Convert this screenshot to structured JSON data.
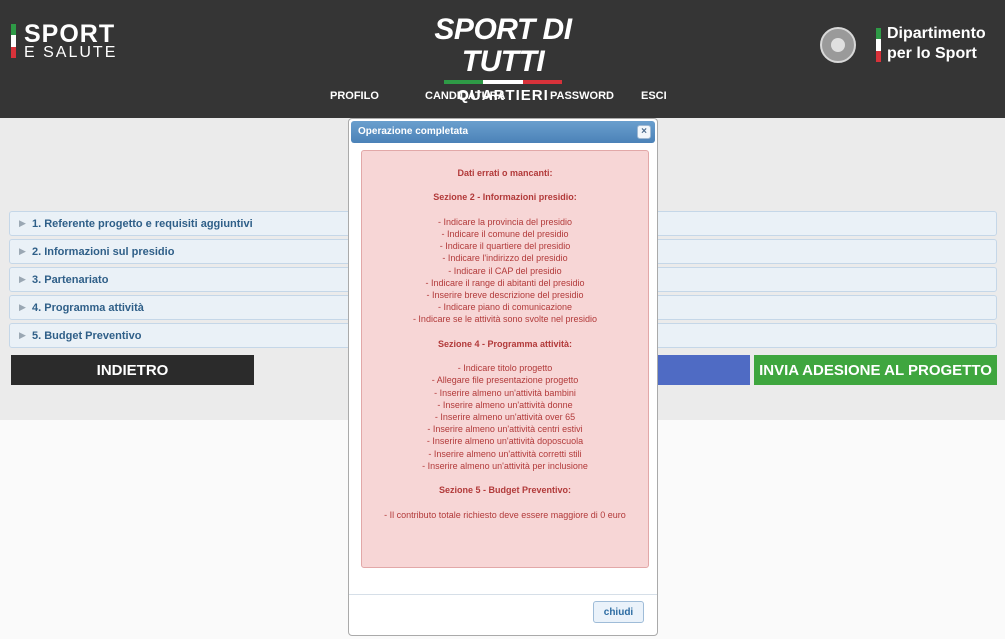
{
  "header": {
    "left_logo": {
      "line1": "SPORT",
      "line2": "E SALUTE"
    },
    "center_logo": {
      "line1": "SPORT DI TUTTI",
      "line2": "QUARTIERI"
    },
    "right_logo": {
      "line1": "Dipartimento",
      "line2": "per lo Sport"
    },
    "flag_colors": [
      "#2e9a46",
      "#ffffff",
      "#d8323a"
    ]
  },
  "nav": [
    "PROFILO",
    "CANDIDATURA",
    "PASSWORD",
    "ESCI"
  ],
  "accordion": [
    "1. Referente progetto e requisiti aggiuntivi",
    "2. Informazioni sul presidio",
    "3. Partenariato",
    "4. Programma attività",
    "5. Budget Preventivo"
  ],
  "buttons": {
    "back": "INDIETRO",
    "send": "INVIA ADESIONE AL PROGETTO"
  },
  "modal": {
    "title": "Operazione completata",
    "close_icon": "×",
    "close_button": "chiudi",
    "lines": [
      {
        "text": "Dati errati o mancanti:",
        "bold": true
      },
      {
        "text": "",
        "bold": false
      },
      {
        "text": "Sezione 2 - Informazioni presidio:",
        "bold": true
      },
      {
        "text": "",
        "bold": false
      },
      {
        "text": "- Indicare la provincia del presidio",
        "bold": false
      },
      {
        "text": "- Indicare il comune del presidio",
        "bold": false
      },
      {
        "text": "- Indicare il quartiere del presidio",
        "bold": false
      },
      {
        "text": "- Indicare l'indirizzo del presidio",
        "bold": false
      },
      {
        "text": "- Indicare il CAP del presidio",
        "bold": false
      },
      {
        "text": "- Indicare il range di abitanti del presidio",
        "bold": false
      },
      {
        "text": "- Inserire breve descrizione del presidio",
        "bold": false
      },
      {
        "text": "- Indicare piano di comunicazione",
        "bold": false
      },
      {
        "text": "- Indicare se le attività sono svolte nel presidio",
        "bold": false
      },
      {
        "text": "",
        "bold": false
      },
      {
        "text": "Sezione 4 - Programma attività:",
        "bold": true
      },
      {
        "text": "",
        "bold": false
      },
      {
        "text": "- Indicare titolo progetto",
        "bold": false
      },
      {
        "text": "- Allegare file presentazione progetto",
        "bold": false
      },
      {
        "text": "- Inserire almeno un'attività bambini",
        "bold": false
      },
      {
        "text": "- Inserire almeno un'attività donne",
        "bold": false
      },
      {
        "text": "- Inserire almeno un'attività over 65",
        "bold": false
      },
      {
        "text": "- Inserire almeno un'attività centri estivi",
        "bold": false
      },
      {
        "text": "- Inserire almeno un'attività doposcuola",
        "bold": false
      },
      {
        "text": "- Inserire almeno un'attività corretti stili",
        "bold": false
      },
      {
        "text": "- Inserire almeno un'attività per inclusione",
        "bold": false
      },
      {
        "text": "",
        "bold": false
      },
      {
        "text": "Sezione 5 - Budget Preventivo:",
        "bold": true
      },
      {
        "text": "",
        "bold": false
      },
      {
        "text": "- Il contributo totale richiesto deve essere maggiore di 0 euro",
        "bold": false
      }
    ]
  }
}
